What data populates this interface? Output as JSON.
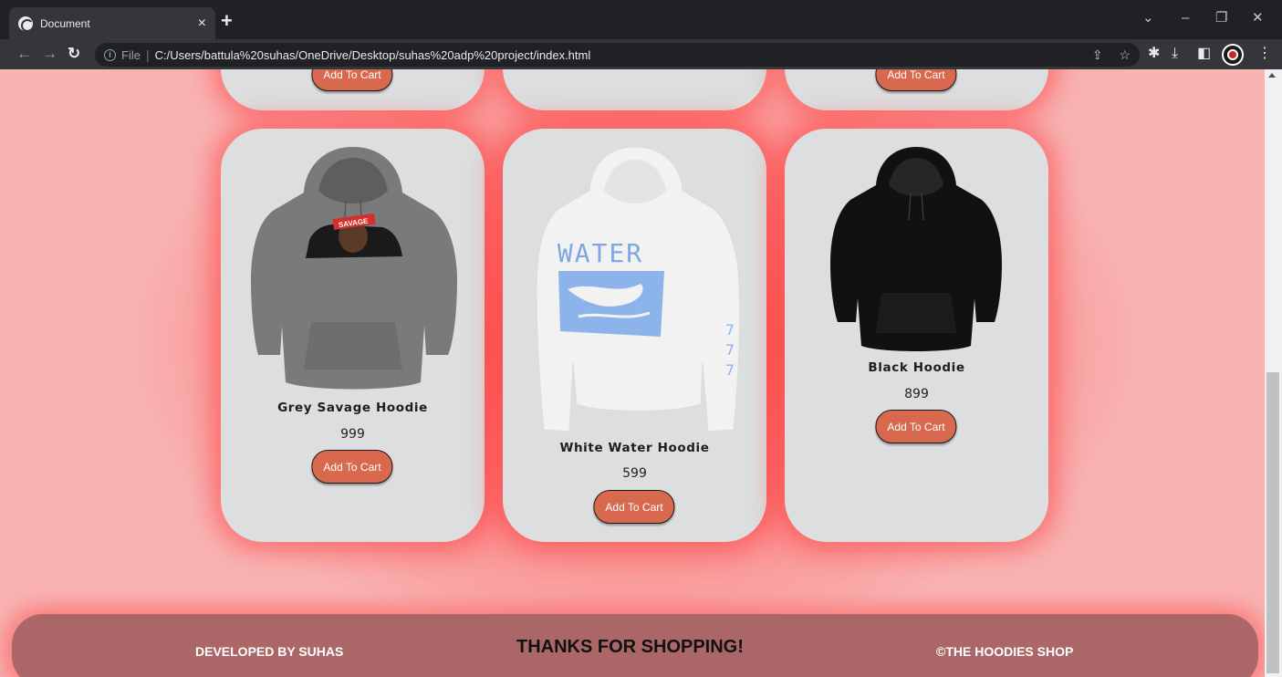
{
  "browser": {
    "tab_title": "Document",
    "tab_close": "×",
    "new_tab": "+",
    "scheme": "File",
    "separator": "|",
    "url": "C:/Users/battula%20suhas/OneDrive/Desktop/suhas%20adp%20project/index.html",
    "window_controls": {
      "minimize": "–",
      "restore": "❐",
      "close": "✕",
      "dropdown": "⌄"
    }
  },
  "top_row": {
    "add_to_cart_label": "Add To Cart"
  },
  "products": [
    {
      "name": "Grey Savage Hoodie",
      "price": "999",
      "button": "Add To Cart",
      "color": "#7a7a7a",
      "print": "SAVAGE"
    },
    {
      "name": "White Water Hoodie",
      "price": "599",
      "button": "Add To Cart",
      "color": "#f2f2f2",
      "print": "WATER"
    },
    {
      "name": "Black Hoodie",
      "price": "899",
      "button": "Add To Cart",
      "color": "#111111"
    }
  ],
  "footer": {
    "left": "DEVELOPED BY SUHAS",
    "center": "THANKS FOR SHOPPING!",
    "right": "©THE HOODIES SHOP"
  },
  "colors": {
    "page_bg": "#f8b3b3",
    "glow": "#ff4646",
    "card_bg": "#dcdedf",
    "button_bg": "#d9694e",
    "footer_bg": "#ab6767"
  }
}
